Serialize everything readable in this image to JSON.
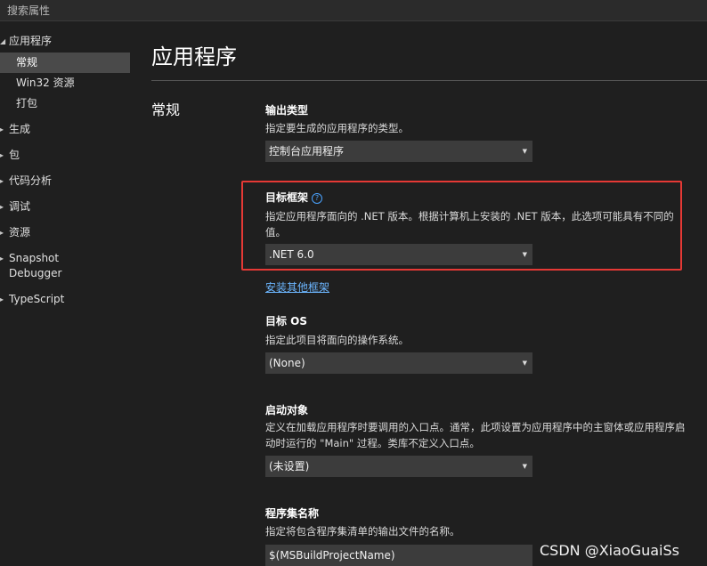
{
  "search": {
    "label": "搜索属性"
  },
  "sidebar": {
    "groups": [
      {
        "label": "应用程序",
        "expanded": true,
        "items": [
          {
            "label": "常规",
            "selected": true
          },
          {
            "label": "Win32 资源"
          },
          {
            "label": "打包"
          }
        ]
      },
      {
        "label": "生成"
      },
      {
        "label": "包"
      },
      {
        "label": "代码分析"
      },
      {
        "label": "调试"
      },
      {
        "label": "资源"
      },
      {
        "label": "Snapshot Debugger",
        "line1": "Snapshot",
        "line2": "Debugger"
      },
      {
        "label": "TypeScript"
      }
    ]
  },
  "main": {
    "title": "应用程序",
    "section": "常规",
    "output_type": {
      "label": "输出类型",
      "description": "指定要生成的应用程序的类型。",
      "value": "控制台应用程序"
    },
    "target_framework": {
      "label": "目标框架",
      "help_icon": "question-circle-icon",
      "description_line1": "指定应用程序面向的 .NET 版本。根据计算机上安装的 .NET 版本，此选项可能具有不同的",
      "description_line2": "值。",
      "value": ".NET 6.0",
      "install_link": "安装其他框架"
    },
    "target_os": {
      "label": "目标 OS",
      "description": "指定此项目将面向的操作系统。",
      "value": "(None)"
    },
    "startup_object": {
      "label": "启动对象",
      "description_line1": "定义在加载应用程序时要调用的入口点。通常，此项设置为应用程序中的主窗体或应用程序启",
      "description_line2": "动时运行的 \"Main\" 过程。类库不定义入口点。",
      "value": "(未设置)"
    },
    "assembly_name": {
      "label": "程序集名称",
      "description": "指定将包含程序集清单的输出文件的名称。",
      "value": "$(MSBuildProjectName)"
    }
  },
  "watermark": "CSDN @XiaoGuaiSs",
  "colors": {
    "highlight": "#e53935",
    "link": "#6cb6ff",
    "background": "#1f1f1f"
  }
}
